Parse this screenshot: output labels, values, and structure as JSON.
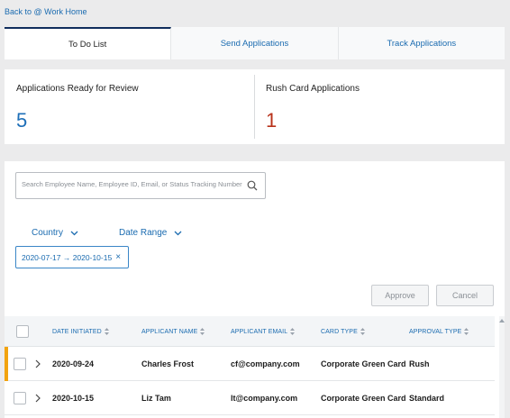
{
  "header": {
    "back_link": "Back to @ Work Home"
  },
  "tabs": [
    {
      "label": "To Do List"
    },
    {
      "label": "Send Applications"
    },
    {
      "label": "Track Applications"
    }
  ],
  "summary": {
    "ready": {
      "title": "Applications Ready for Review",
      "count": "5"
    },
    "rush": {
      "title": "Rush Card Applications",
      "count": "1"
    }
  },
  "search": {
    "placeholder": "Search Employee Name, Employee ID, Email, or Status Tracking Number",
    "value": ""
  },
  "filters": {
    "country": "Country",
    "date_range": "Date Range",
    "chip": "2020-07-17 → 2020-10-15"
  },
  "actions": {
    "approve": "Approve",
    "cancel": "Cancel"
  },
  "table": {
    "columns": [
      "DATE INITIATED",
      "APPLICANT NAME",
      "APPLICANT EMAIL",
      "CARD TYPE",
      "APPROVAL TYPE"
    ],
    "rows": [
      {
        "date": "2020-09-24",
        "name": "Charles Frost",
        "email": "cf@company.com",
        "card": "Corporate Green Card",
        "approval": "Rush"
      },
      {
        "date": "2020-10-15",
        "name": "Liz Tam",
        "email": "lt@company.com",
        "card": "Corporate Green Card",
        "approval": "Standard"
      }
    ]
  },
  "colors": {
    "accent": "#1a6bb0",
    "rush_count": "#b8321a",
    "row_flag": "#f2a30f",
    "active_tab": "#0f2c5c"
  },
  "icons": [
    "search-icon",
    "chevron-down-icon",
    "close-icon",
    "sort-icon",
    "chevron-right-icon"
  ]
}
